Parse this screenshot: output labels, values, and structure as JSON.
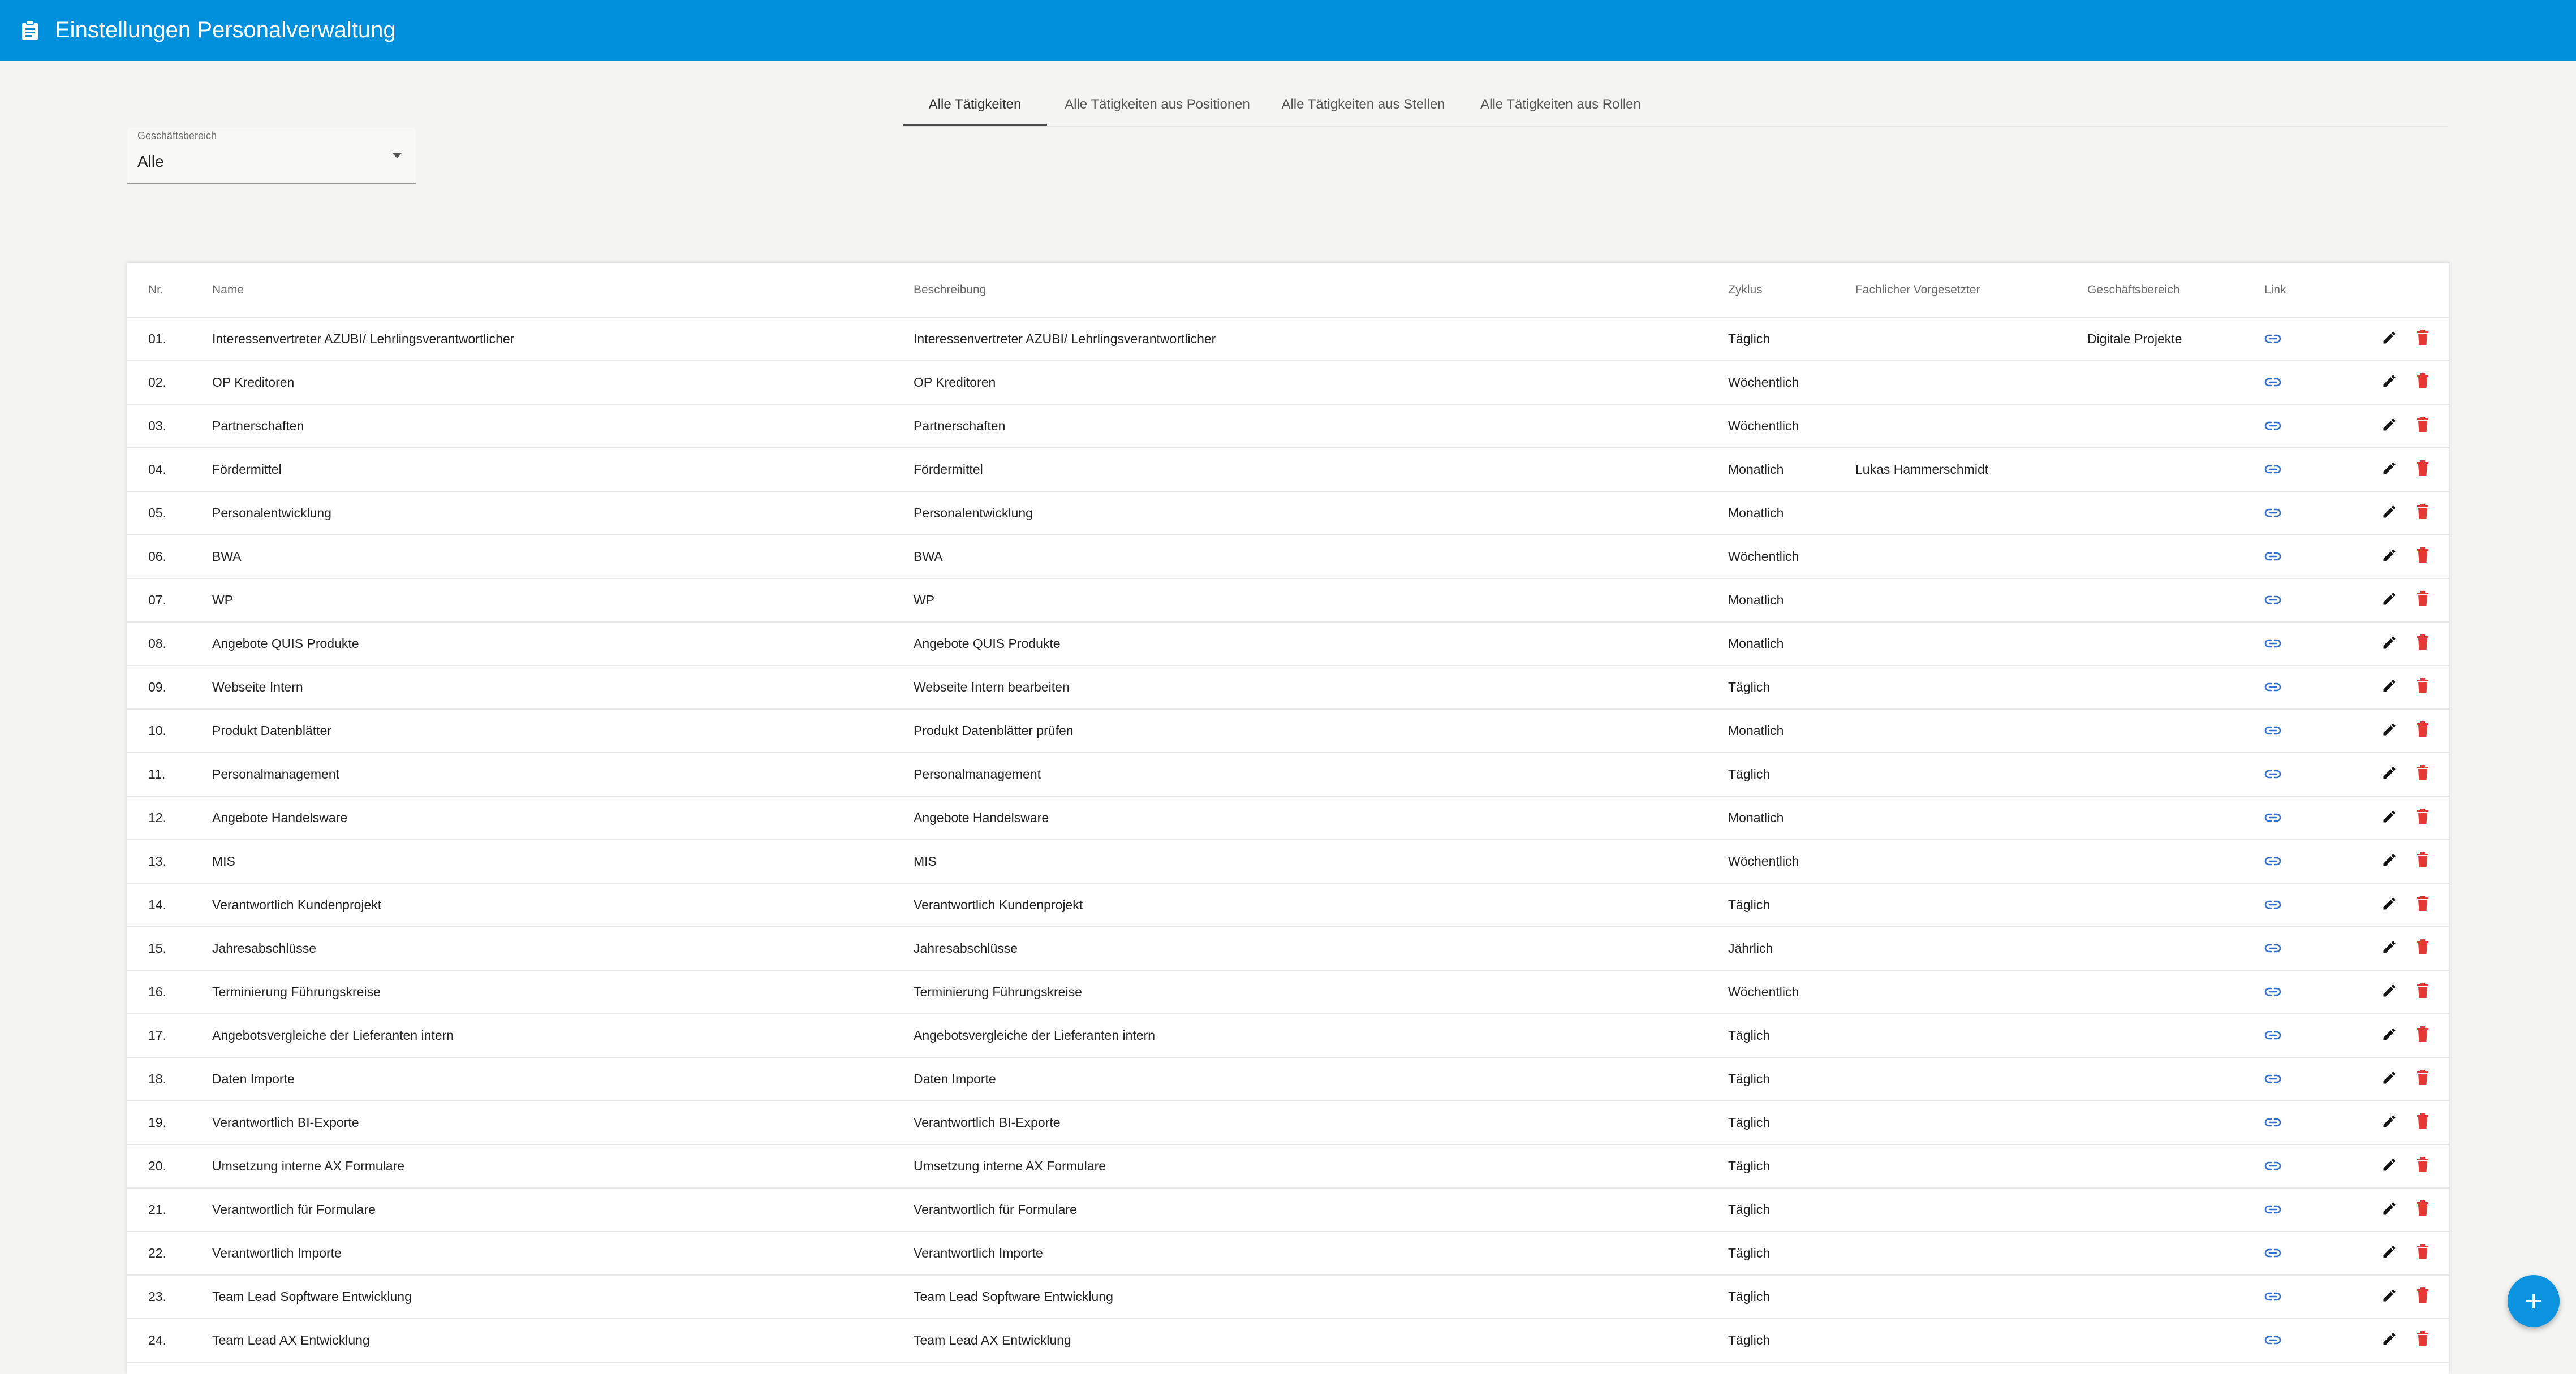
{
  "header": {
    "title": "Einstellungen Personalverwaltung",
    "icon": "clipboard-icon"
  },
  "tabs": [
    {
      "label": "Alle Tätigkeiten",
      "active": true
    },
    {
      "label": "Alle Tätigkeiten aus Positionen",
      "active": false
    },
    {
      "label": "Alle Tätigkeiten aus Stellen",
      "active": false
    },
    {
      "label": "Alle Tätigkeiten aus Rollen",
      "active": false
    }
  ],
  "filter": {
    "label": "Geschäftsbereich",
    "value": "Alle"
  },
  "table": {
    "columns": [
      "Nr.",
      "Name",
      "Beschreibung",
      "Zyklus",
      "Fachlicher Vorgesetzter",
      "Geschäftsbereich",
      "Link"
    ],
    "rows": [
      {
        "nr": "01.",
        "name": "Interessenvertreter AZUBI/ Lehrlingsverantwortlicher",
        "beschreibung": "Interessenvertreter AZUBI/ Lehrlingsverantwortlicher",
        "zyklus": "Täglich",
        "vorgesetzter": "",
        "bereich": "Digitale Projekte"
      },
      {
        "nr": "02.",
        "name": "OP Kreditoren",
        "beschreibung": "OP Kreditoren",
        "zyklus": "Wöchentlich",
        "vorgesetzter": "",
        "bereich": ""
      },
      {
        "nr": "03.",
        "name": "Partnerschaften",
        "beschreibung": "Partnerschaften",
        "zyklus": "Wöchentlich",
        "vorgesetzter": "",
        "bereich": ""
      },
      {
        "nr": "04.",
        "name": "Fördermittel",
        "beschreibung": "Fördermittel",
        "zyklus": "Monatlich",
        "vorgesetzter": "Lukas Hammerschmidt",
        "bereich": ""
      },
      {
        "nr": "05.",
        "name": "Personalentwicklung",
        "beschreibung": "Personalentwicklung",
        "zyklus": "Monatlich",
        "vorgesetzter": "",
        "bereich": ""
      },
      {
        "nr": "06.",
        "name": "BWA",
        "beschreibung": "BWA",
        "zyklus": "Wöchentlich",
        "vorgesetzter": "",
        "bereich": ""
      },
      {
        "nr": "07.",
        "name": "WP",
        "beschreibung": "WP",
        "zyklus": "Monatlich",
        "vorgesetzter": "",
        "bereich": ""
      },
      {
        "nr": "08.",
        "name": "Angebote QUIS Produkte",
        "beschreibung": "Angebote QUIS Produkte",
        "zyklus": "Monatlich",
        "vorgesetzter": "",
        "bereich": ""
      },
      {
        "nr": "09.",
        "name": "Webseite Intern",
        "beschreibung": "Webseite Intern bearbeiten",
        "zyklus": "Täglich",
        "vorgesetzter": "",
        "bereich": ""
      },
      {
        "nr": "10.",
        "name": "Produkt Datenblätter",
        "beschreibung": "Produkt Datenblätter prüfen",
        "zyklus": "Monatlich",
        "vorgesetzter": "",
        "bereich": ""
      },
      {
        "nr": "11.",
        "name": "Personalmanagement",
        "beschreibung": "Personalmanagement",
        "zyklus": "Täglich",
        "vorgesetzter": "",
        "bereich": ""
      },
      {
        "nr": "12.",
        "name": "Angebote Handelsware",
        "beschreibung": "Angebote Handelsware",
        "zyklus": "Monatlich",
        "vorgesetzter": "",
        "bereich": ""
      },
      {
        "nr": "13.",
        "name": "MIS",
        "beschreibung": "MIS",
        "zyklus": "Wöchentlich",
        "vorgesetzter": "",
        "bereich": ""
      },
      {
        "nr": "14.",
        "name": "Verantwortlich Kundenprojekt",
        "beschreibung": "Verantwortlich Kundenprojekt",
        "zyklus": "Täglich",
        "vorgesetzter": "",
        "bereich": ""
      },
      {
        "nr": "15.",
        "name": "Jahresabschlüsse",
        "beschreibung": "Jahresabschlüsse",
        "zyklus": "Jährlich",
        "vorgesetzter": "",
        "bereich": ""
      },
      {
        "nr": "16.",
        "name": "Terminierung Führungskreise",
        "beschreibung": "Terminierung Führungskreise",
        "zyklus": "Wöchentlich",
        "vorgesetzter": "",
        "bereich": ""
      },
      {
        "nr": "17.",
        "name": "Angebotsvergleiche der Lieferanten intern",
        "beschreibung": "Angebotsvergleiche der Lieferanten intern",
        "zyklus": "Täglich",
        "vorgesetzter": "",
        "bereich": ""
      },
      {
        "nr": "18.",
        "name": "Daten Importe",
        "beschreibung": "Daten Importe",
        "zyklus": "Täglich",
        "vorgesetzter": "",
        "bereich": ""
      },
      {
        "nr": "19.",
        "name": "Verantwortlich BI-Exporte",
        "beschreibung": "Verantwortlich BI-Exporte",
        "zyklus": "Täglich",
        "vorgesetzter": "",
        "bereich": ""
      },
      {
        "nr": "20.",
        "name": "Umsetzung interne AX Formulare",
        "beschreibung": "Umsetzung interne AX Formulare",
        "zyklus": "Täglich",
        "vorgesetzter": "",
        "bereich": ""
      },
      {
        "nr": "21.",
        "name": "Verantwortlich für Formulare",
        "beschreibung": "Verantwortlich für Formulare",
        "zyklus": "Täglich",
        "vorgesetzter": "",
        "bereich": ""
      },
      {
        "nr": "22.",
        "name": "Verantwortlich Importe",
        "beschreibung": "Verantwortlich Importe",
        "zyklus": "Täglich",
        "vorgesetzter": "",
        "bereich": ""
      },
      {
        "nr": "23.",
        "name": "Team Lead Sopftware Entwicklung",
        "beschreibung": "Team Lead Sopftware Entwicklung",
        "zyklus": "Täglich",
        "vorgesetzter": "",
        "bereich": ""
      },
      {
        "nr": "24.",
        "name": "Team Lead AX Entwicklung",
        "beschreibung": "Team Lead AX Entwicklung",
        "zyklus": "Täglich",
        "vorgesetzter": "",
        "bereich": ""
      }
    ]
  },
  "colors": {
    "primary": "#0090dc",
    "link": "#2f6fd3",
    "delete": "#e53935",
    "edit": "#111111"
  },
  "icons": {
    "link": "link-icon",
    "edit": "pencil-icon",
    "delete": "trash-icon",
    "fab": "plus-icon"
  }
}
